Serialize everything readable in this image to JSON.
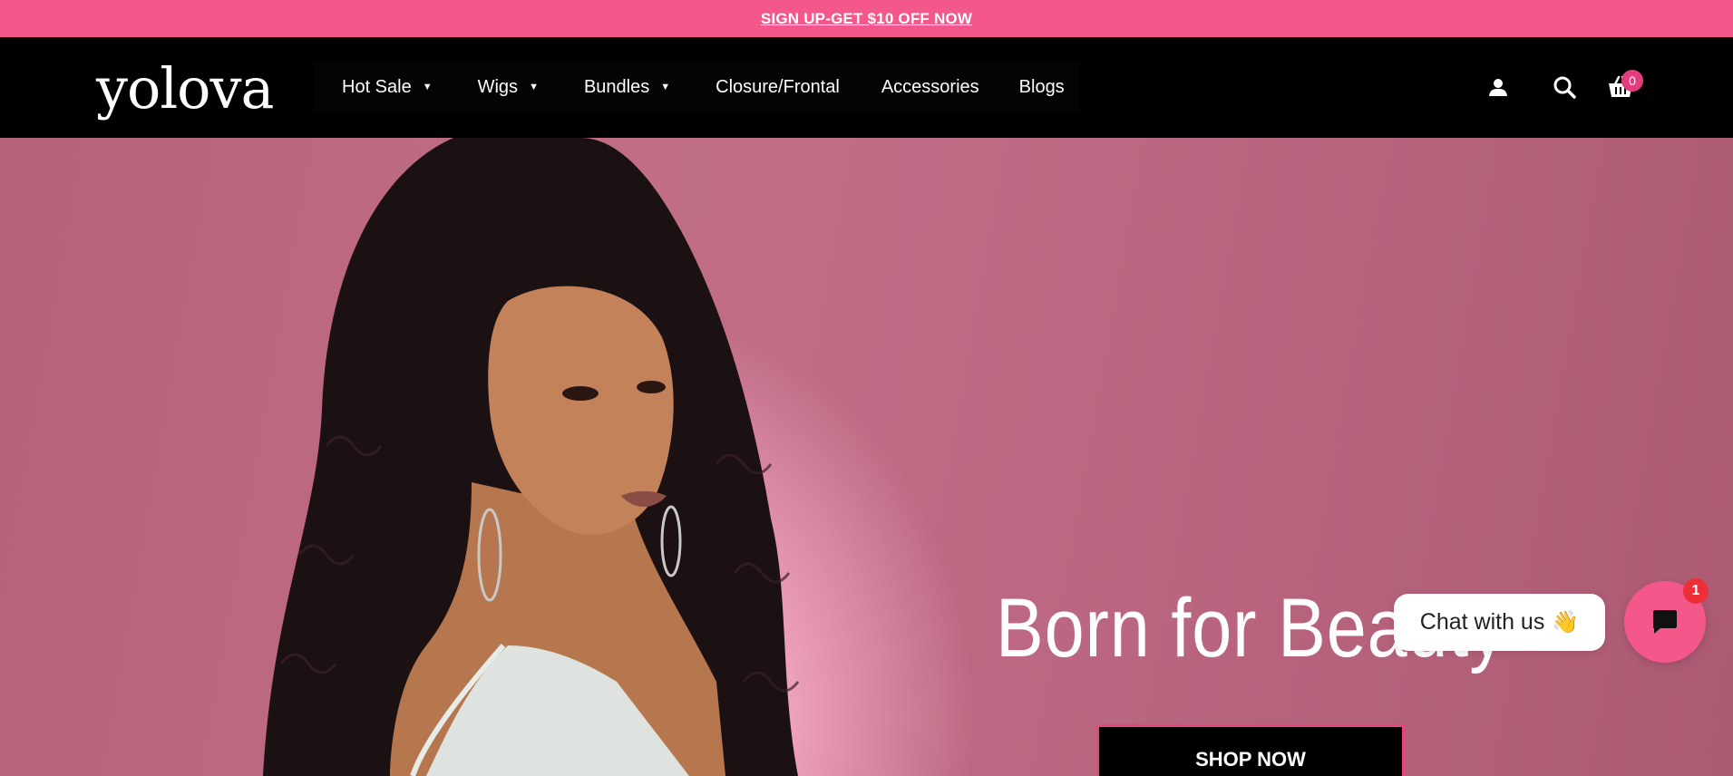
{
  "announcement": {
    "text": "SIGN UP-GET $10 OFF NOW"
  },
  "header": {
    "logo": "yolova",
    "nav": [
      {
        "label": "Hot Sale",
        "has_dropdown": true
      },
      {
        "label": "Wigs",
        "has_dropdown": true
      },
      {
        "label": "Bundles",
        "has_dropdown": true
      },
      {
        "label": "Closure/Frontal",
        "has_dropdown": false
      },
      {
        "label": "Accessories",
        "has_dropdown": false
      },
      {
        "label": "Blogs",
        "has_dropdown": false
      }
    ],
    "dropdown_glyph": "▼",
    "icons": [
      "account-icon",
      "search-icon",
      "cart-icon"
    ],
    "cart_count": "0"
  },
  "hero": {
    "title": "Born for Beauty",
    "cta": "SHOP NOW"
  },
  "chat": {
    "label": "Chat with us",
    "emoji": "👋",
    "unread_count": "1"
  },
  "colors": {
    "accent_pink": "#f4578a",
    "header_bg": "#000000",
    "hero_bg": "#bd6882"
  }
}
